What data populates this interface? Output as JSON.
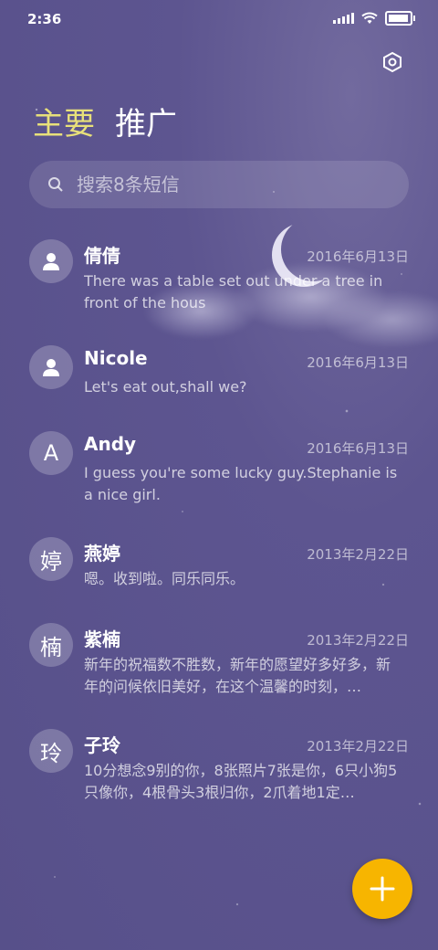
{
  "status_bar": {
    "time": "2:36"
  },
  "tabs": [
    {
      "label": "主要",
      "active": true
    },
    {
      "label": "推广",
      "active": false
    }
  ],
  "search": {
    "placeholder": "搜索8条短信"
  },
  "conversations": [
    {
      "avatar": "person-icon",
      "name": "倩倩",
      "date": "2016年6月13日",
      "snippet": "There was a table set out under a tree in front of the hous"
    },
    {
      "avatar": "person-icon",
      "name": "Nicole",
      "date": "2016年6月13日",
      "snippet": "Let's eat out,shall we?"
    },
    {
      "avatar": "A",
      "name": "Andy",
      "date": "2016年6月13日",
      "snippet": "I guess you're some lucky guy.Stephanie is a nice girl."
    },
    {
      "avatar": "婷",
      "name": "燕婷",
      "date": "2013年2月22日",
      "snippet": "嗯。收到啦。同乐同乐。"
    },
    {
      "avatar": "楠",
      "name": "紫楠",
      "date": "2013年2月22日",
      "snippet": "新年的祝福数不胜数，新年的愿望好多好多，新年的问候依旧美好，在这个温馨的时刻，…"
    },
    {
      "avatar": "玲",
      "name": "子玲",
      "date": "2013年2月22日",
      "snippet": "10分想念9别的你，8张照片7张是你，6只小狗5只像你，4根骨头3根归你，2爪着地1定…"
    }
  ],
  "colors": {
    "accent_tab": "#e8e07a",
    "fab": "#f7b500",
    "background": "#5d5590"
  },
  "icons": {
    "settings": "settings-icon",
    "search": "search-icon",
    "compose": "plus-icon"
  }
}
